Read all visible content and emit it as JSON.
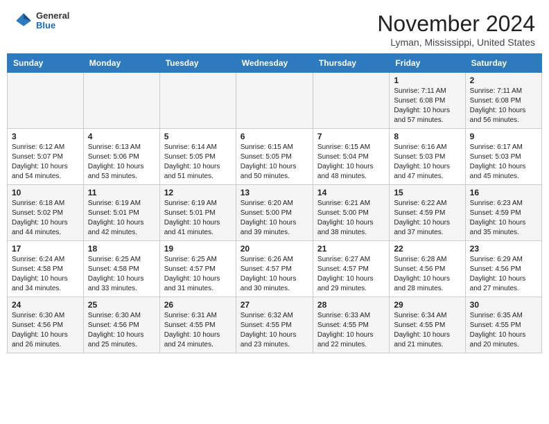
{
  "header": {
    "logo_general": "General",
    "logo_blue": "Blue",
    "month_title": "November 2024",
    "location": "Lyman, Mississippi, United States"
  },
  "weekdays": [
    "Sunday",
    "Monday",
    "Tuesday",
    "Wednesday",
    "Thursday",
    "Friday",
    "Saturday"
  ],
  "weeks": [
    [
      {
        "day": "",
        "info": ""
      },
      {
        "day": "",
        "info": ""
      },
      {
        "day": "",
        "info": ""
      },
      {
        "day": "",
        "info": ""
      },
      {
        "day": "",
        "info": ""
      },
      {
        "day": "1",
        "info": "Sunrise: 7:11 AM\nSunset: 6:08 PM\nDaylight: 10 hours and 57 minutes."
      },
      {
        "day": "2",
        "info": "Sunrise: 7:11 AM\nSunset: 6:08 PM\nDaylight: 10 hours and 56 minutes."
      }
    ],
    [
      {
        "day": "3",
        "info": "Sunrise: 6:12 AM\nSunset: 5:07 PM\nDaylight: 10 hours and 54 minutes."
      },
      {
        "day": "4",
        "info": "Sunrise: 6:13 AM\nSunset: 5:06 PM\nDaylight: 10 hours and 53 minutes."
      },
      {
        "day": "5",
        "info": "Sunrise: 6:14 AM\nSunset: 5:05 PM\nDaylight: 10 hours and 51 minutes."
      },
      {
        "day": "6",
        "info": "Sunrise: 6:15 AM\nSunset: 5:05 PM\nDaylight: 10 hours and 50 minutes."
      },
      {
        "day": "7",
        "info": "Sunrise: 6:15 AM\nSunset: 5:04 PM\nDaylight: 10 hours and 48 minutes."
      },
      {
        "day": "8",
        "info": "Sunrise: 6:16 AM\nSunset: 5:03 PM\nDaylight: 10 hours and 47 minutes."
      },
      {
        "day": "9",
        "info": "Sunrise: 6:17 AM\nSunset: 5:03 PM\nDaylight: 10 hours and 45 minutes."
      }
    ],
    [
      {
        "day": "10",
        "info": "Sunrise: 6:18 AM\nSunset: 5:02 PM\nDaylight: 10 hours and 44 minutes."
      },
      {
        "day": "11",
        "info": "Sunrise: 6:19 AM\nSunset: 5:01 PM\nDaylight: 10 hours and 42 minutes."
      },
      {
        "day": "12",
        "info": "Sunrise: 6:19 AM\nSunset: 5:01 PM\nDaylight: 10 hours and 41 minutes."
      },
      {
        "day": "13",
        "info": "Sunrise: 6:20 AM\nSunset: 5:00 PM\nDaylight: 10 hours and 39 minutes."
      },
      {
        "day": "14",
        "info": "Sunrise: 6:21 AM\nSunset: 5:00 PM\nDaylight: 10 hours and 38 minutes."
      },
      {
        "day": "15",
        "info": "Sunrise: 6:22 AM\nSunset: 4:59 PM\nDaylight: 10 hours and 37 minutes."
      },
      {
        "day": "16",
        "info": "Sunrise: 6:23 AM\nSunset: 4:59 PM\nDaylight: 10 hours and 35 minutes."
      }
    ],
    [
      {
        "day": "17",
        "info": "Sunrise: 6:24 AM\nSunset: 4:58 PM\nDaylight: 10 hours and 34 minutes."
      },
      {
        "day": "18",
        "info": "Sunrise: 6:25 AM\nSunset: 4:58 PM\nDaylight: 10 hours and 33 minutes."
      },
      {
        "day": "19",
        "info": "Sunrise: 6:25 AM\nSunset: 4:57 PM\nDaylight: 10 hours and 31 minutes."
      },
      {
        "day": "20",
        "info": "Sunrise: 6:26 AM\nSunset: 4:57 PM\nDaylight: 10 hours and 30 minutes."
      },
      {
        "day": "21",
        "info": "Sunrise: 6:27 AM\nSunset: 4:57 PM\nDaylight: 10 hours and 29 minutes."
      },
      {
        "day": "22",
        "info": "Sunrise: 6:28 AM\nSunset: 4:56 PM\nDaylight: 10 hours and 28 minutes."
      },
      {
        "day": "23",
        "info": "Sunrise: 6:29 AM\nSunset: 4:56 PM\nDaylight: 10 hours and 27 minutes."
      }
    ],
    [
      {
        "day": "24",
        "info": "Sunrise: 6:30 AM\nSunset: 4:56 PM\nDaylight: 10 hours and 26 minutes."
      },
      {
        "day": "25",
        "info": "Sunrise: 6:30 AM\nSunset: 4:56 PM\nDaylight: 10 hours and 25 minutes."
      },
      {
        "day": "26",
        "info": "Sunrise: 6:31 AM\nSunset: 4:55 PM\nDaylight: 10 hours and 24 minutes."
      },
      {
        "day": "27",
        "info": "Sunrise: 6:32 AM\nSunset: 4:55 PM\nDaylight: 10 hours and 23 minutes."
      },
      {
        "day": "28",
        "info": "Sunrise: 6:33 AM\nSunset: 4:55 PM\nDaylight: 10 hours and 22 minutes."
      },
      {
        "day": "29",
        "info": "Sunrise: 6:34 AM\nSunset: 4:55 PM\nDaylight: 10 hours and 21 minutes."
      },
      {
        "day": "30",
        "info": "Sunrise: 6:35 AM\nSunset: 4:55 PM\nDaylight: 10 hours and 20 minutes."
      }
    ]
  ]
}
